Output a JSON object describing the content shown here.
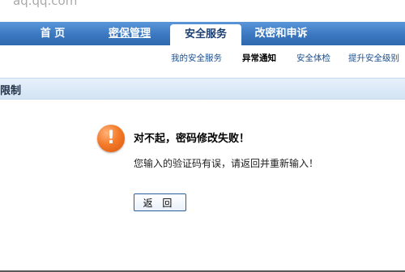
{
  "browser": {
    "domain": "aq.qq.com"
  },
  "nav": {
    "tabs": [
      {
        "label": "首 页"
      },
      {
        "label": "密保管理"
      },
      {
        "label": "安全服务"
      },
      {
        "label": "改密和申诉"
      }
    ]
  },
  "subnav": {
    "links": [
      {
        "label": "我的安全服务"
      },
      {
        "label": "异常通知"
      },
      {
        "label": "安全体检"
      },
      {
        "label": "提升安全级别"
      }
    ]
  },
  "section": {
    "title": "限制"
  },
  "message": {
    "icon": "exclamation-icon",
    "icon_symbol": "!",
    "title": "对不起，密码修改失败！",
    "detail": "您输入的验证码有误，请返回并重新输入！"
  },
  "actions": {
    "back_label": "返 回"
  },
  "colors": {
    "nav_blue": "#3b78c1",
    "link_blue": "#1c4f8f",
    "warning_orange": "#f47b2a",
    "band_blue": "#d3e4f4"
  }
}
